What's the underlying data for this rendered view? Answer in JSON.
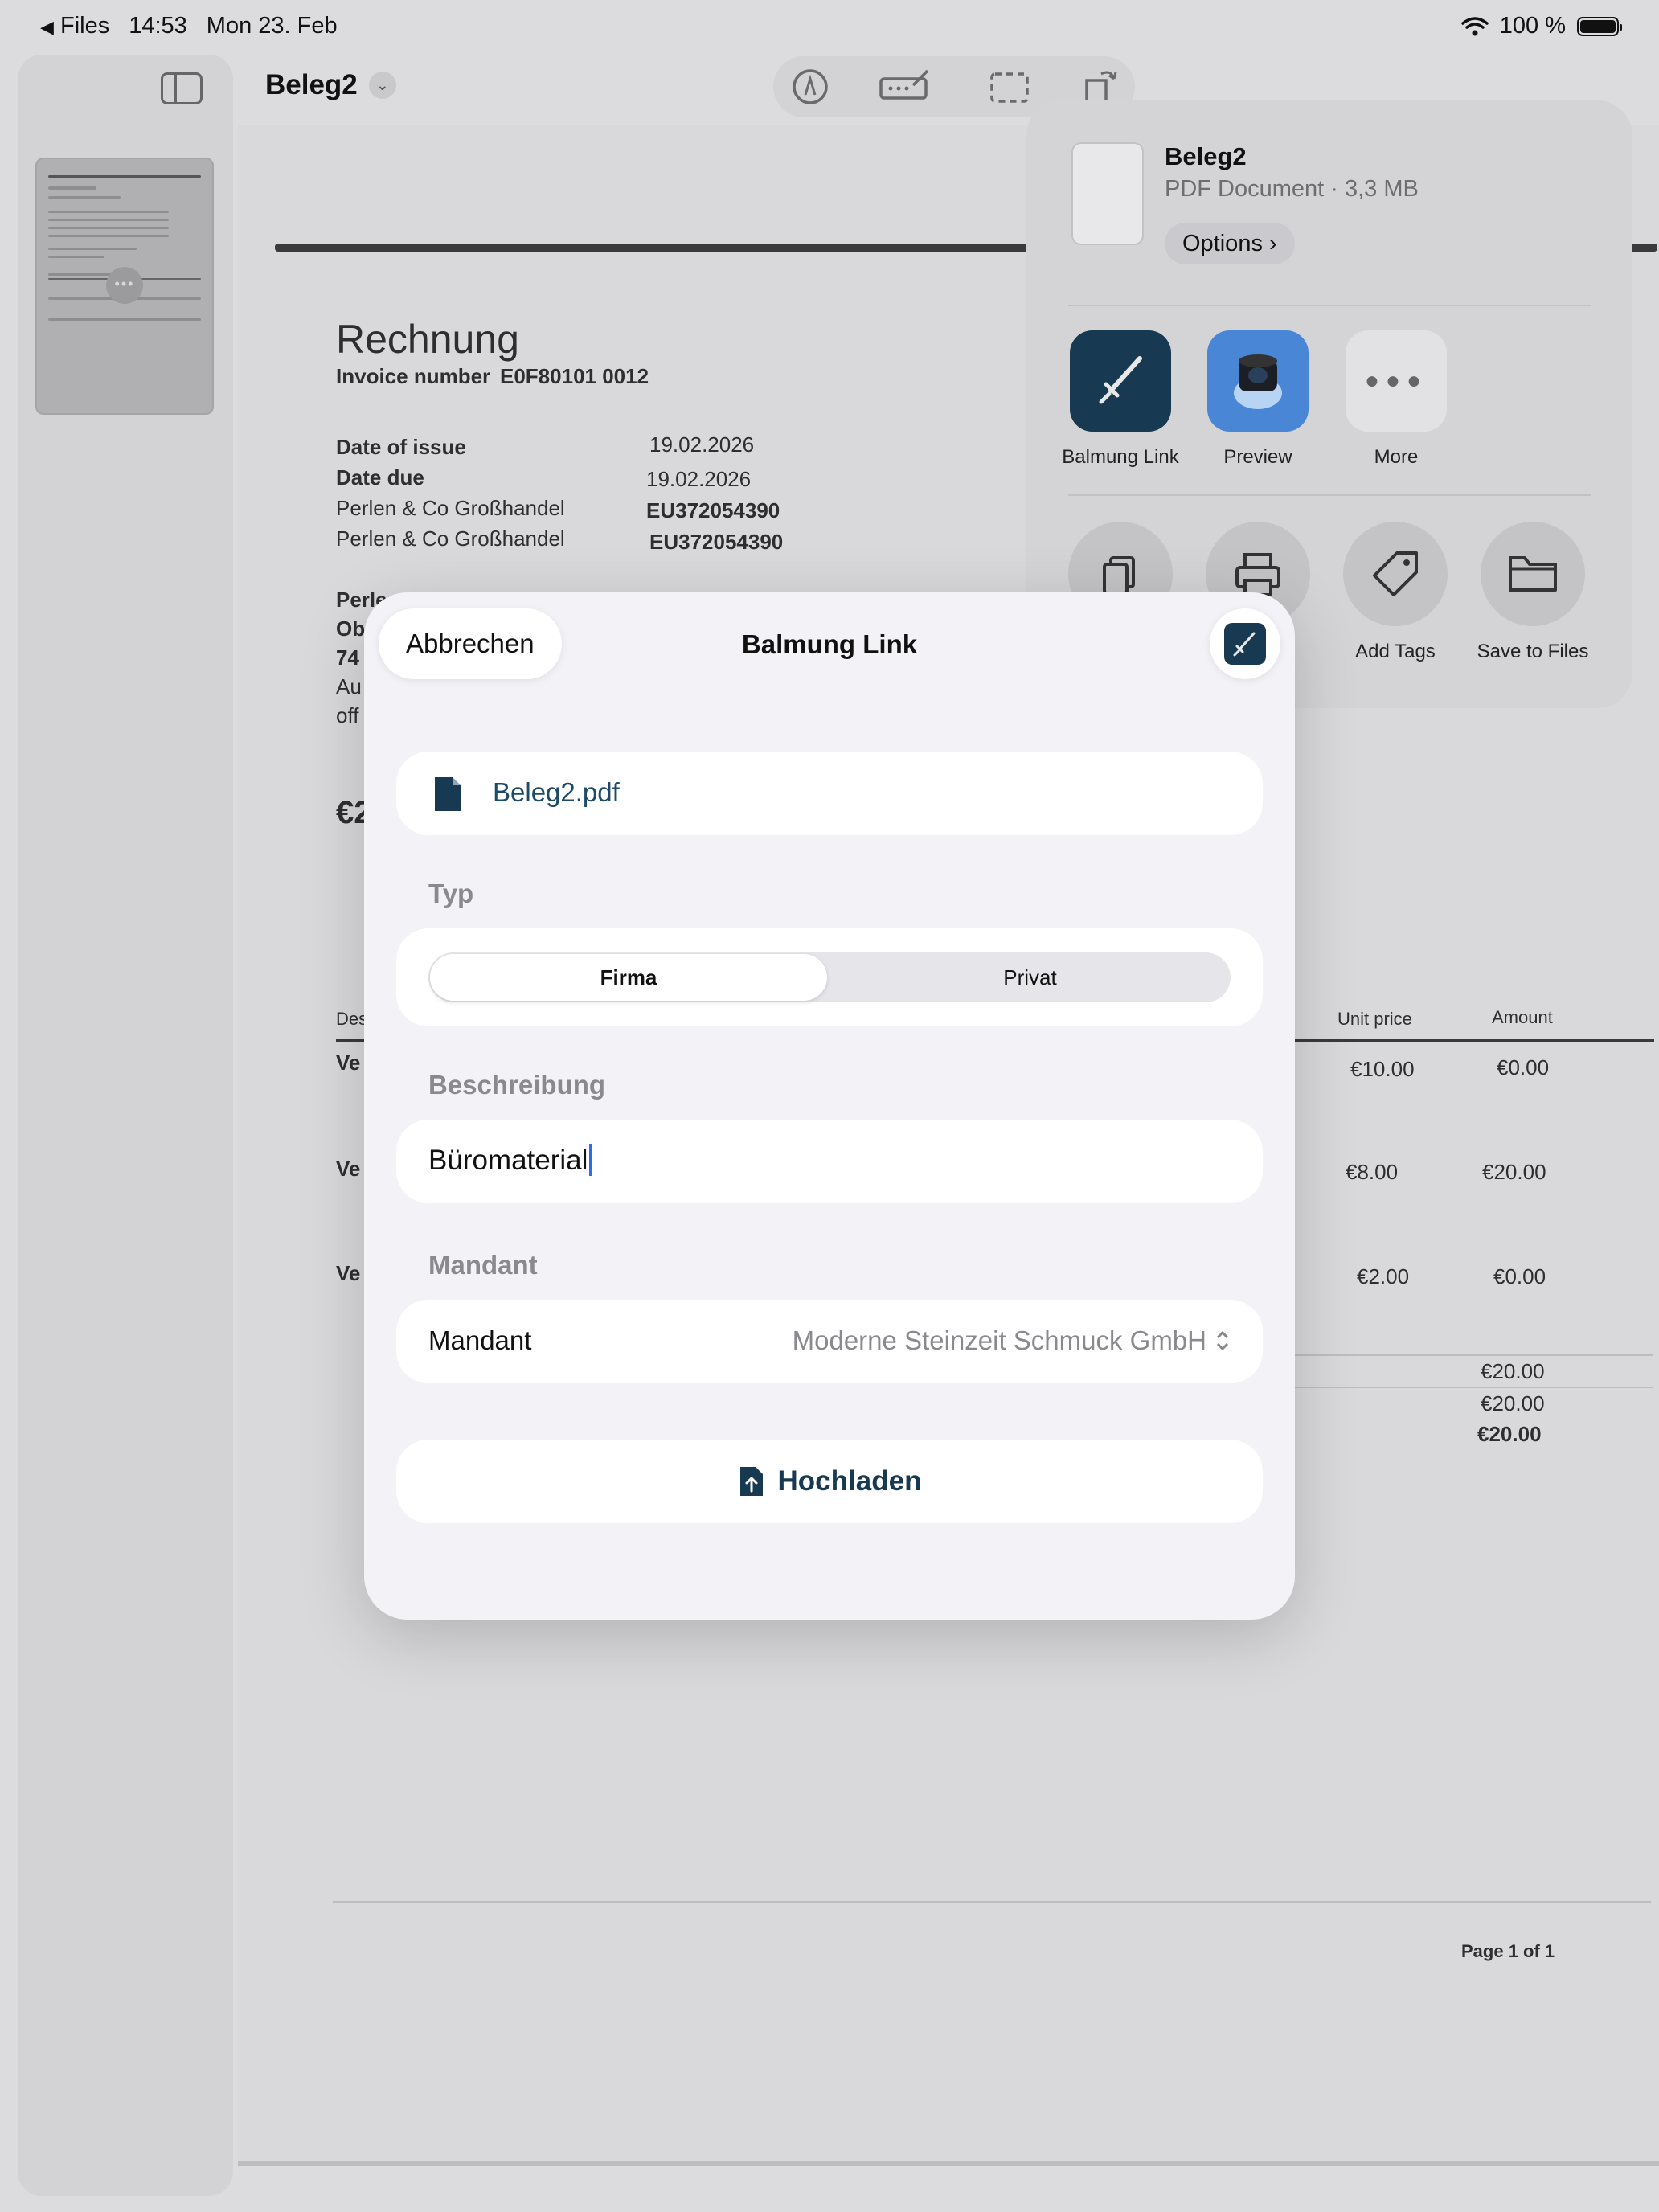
{
  "status_bar": {
    "back_app": "Files",
    "time": "14:53",
    "date": "Mon 23. Feb",
    "battery": "100 %"
  },
  "document": {
    "title": "Beleg2",
    "invoice": {
      "heading": "Rechnung",
      "invoice_number_label": "Invoice number",
      "invoice_number": "E0F80101 0012",
      "date_of_issue_label": "Date of issue",
      "date_of_issue": "19.02.2026",
      "date_due_label": "Date due",
      "date_due": "19.02.2026",
      "party_1": "Perlen & Co Großhandel",
      "vat_1": "EU372054390",
      "party_2": "Perlen & Co Großhandel",
      "vat_2": "EU372054390",
      "address_1": "Perlen",
      "address_2": "Ob",
      "address_3": "74",
      "address_4": "Au",
      "address_5": "off",
      "amount_fragment": "€2",
      "col_desc": "Des",
      "col_unit_price": "Unit price",
      "col_amount": "Amount",
      "rows": [
        {
          "desc": "Ve",
          "unit": "€10.00",
          "amount": "€0.00"
        },
        {
          "desc": "Ve",
          "unit": "€8.00",
          "amount": "€20.00"
        },
        {
          "desc": "Ve",
          "unit": "€2.00",
          "amount": "€0.00"
        }
      ],
      "totals": [
        "€20.00",
        "€20.00",
        "€20.00"
      ],
      "page_label": "Page 1 of 1"
    }
  },
  "share_sheet": {
    "file_name": "Beleg2",
    "file_meta": "PDF Document · 3,3 MB",
    "options_label": "Options",
    "apps": [
      {
        "label": "Balmung Link",
        "icon": "sword-icon"
      },
      {
        "label": "Preview",
        "icon": "preview-icon"
      },
      {
        "label": "More",
        "icon": "more-icon"
      }
    ],
    "actions": [
      {
        "label": "Add Tags",
        "icon": "tag-icon"
      },
      {
        "label": "Save to Files",
        "icon": "folder-icon"
      }
    ]
  },
  "modal": {
    "cancel_label": "Abbrechen",
    "title": "Balmung Link",
    "file_name": "Beleg2.pdf",
    "typ_label": "Typ",
    "typ_options": [
      "Firma",
      "Privat"
    ],
    "typ_selected": "Firma",
    "description_label": "Beschreibung",
    "description_value": "Büromaterial",
    "mandant_section_label": "Mandant",
    "mandant_field_label": "Mandant",
    "mandant_value": "Moderne Steinzeit Schmuck GmbH",
    "upload_label": "Hochladen",
    "colors": {
      "accent": "#173a52",
      "link": "#1d4a68"
    }
  }
}
